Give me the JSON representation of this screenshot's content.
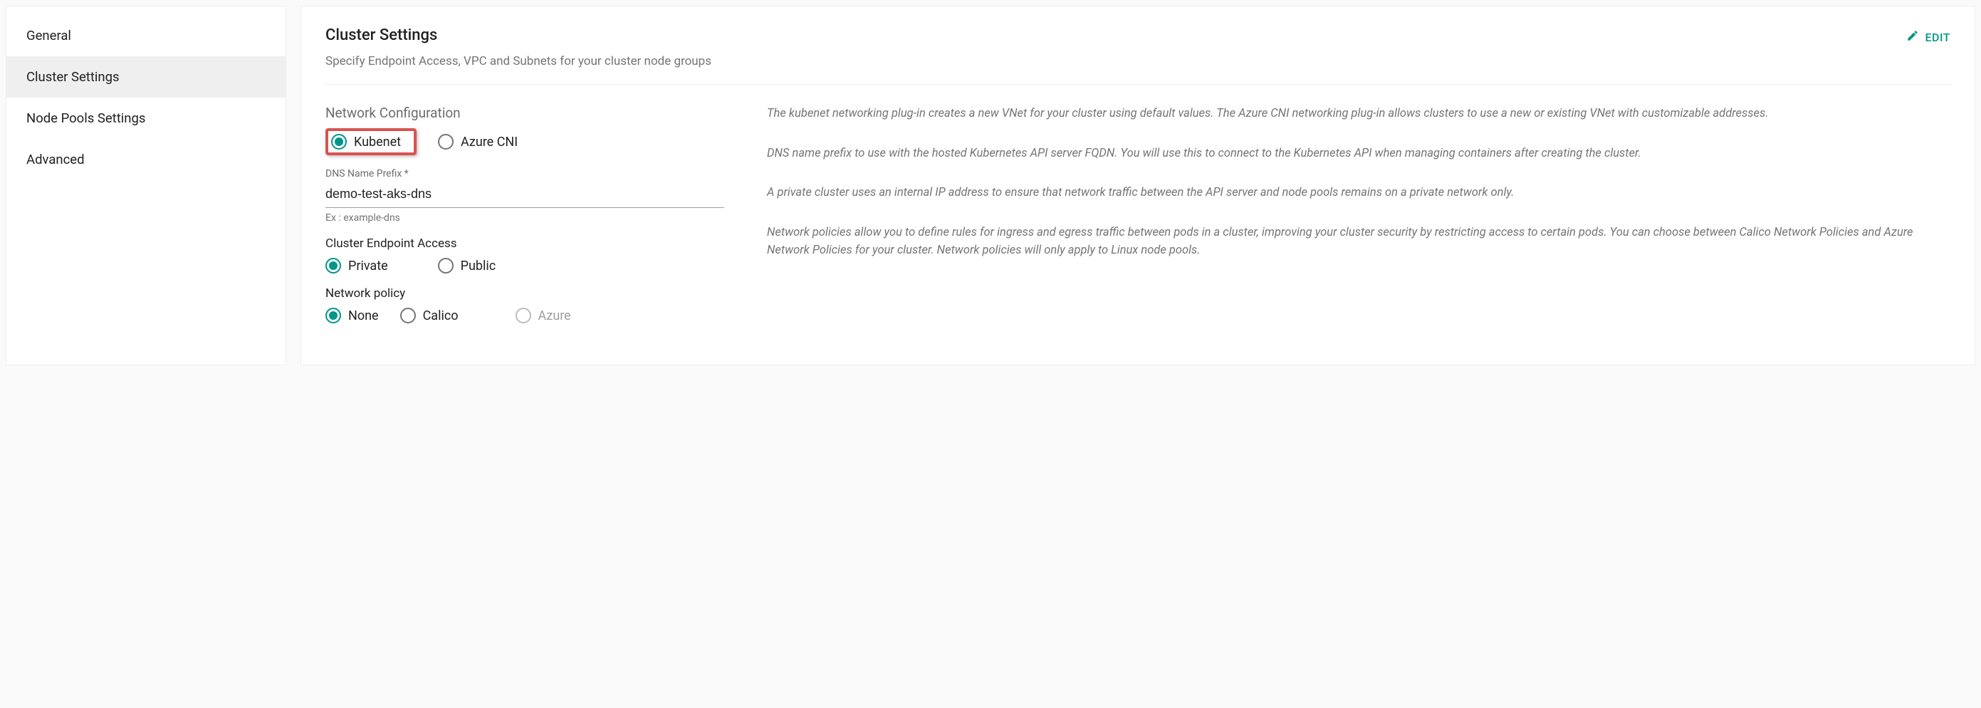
{
  "sidebar": {
    "items": [
      {
        "label": "General",
        "active": false
      },
      {
        "label": "Cluster Settings",
        "active": true
      },
      {
        "label": "Node Pools Settings",
        "active": false
      },
      {
        "label": "Advanced",
        "active": false
      }
    ]
  },
  "header": {
    "title": "Cluster Settings",
    "subtitle": "Specify Endpoint Access, VPC and Subnets for your cluster node groups",
    "edit_label": "EDIT"
  },
  "network": {
    "section_label": "Network Configuration",
    "options": {
      "kubenet": "Kubenet",
      "azure_cni": "Azure CNI"
    },
    "selected": "kubenet",
    "description": "The kubenet networking plug-in creates a new VNet for your cluster using default values. The Azure CNI networking plug-in allows clusters to use a new or existing VNet with customizable addresses."
  },
  "dns": {
    "label": "DNS Name Prefix *",
    "value": "demo-test-aks-dns",
    "helper": "Ex : example-dns",
    "description": "DNS name prefix to use with the hosted Kubernetes API server FQDN. You will use this to connect to the Kubernetes API when managing containers after creating the cluster."
  },
  "endpoint": {
    "label": "Cluster Endpoint Access",
    "options": {
      "private": "Private",
      "public": "Public"
    },
    "selected": "private",
    "description": "A private cluster uses an internal IP address to ensure that network traffic between the API server and node pools remains on a private network only."
  },
  "policy": {
    "label": "Network policy",
    "options": {
      "none": "None",
      "calico": "Calico",
      "azure": "Azure"
    },
    "selected": "none",
    "disabled": [
      "azure"
    ],
    "description": "Network policies allow you to define rules for ingress and egress traffic between pods in a cluster, improving your cluster security by restricting access to certain pods. You can choose between Calico Network Policies and Azure Network Policies for your cluster. Network policies will only apply to Linux node pools."
  }
}
